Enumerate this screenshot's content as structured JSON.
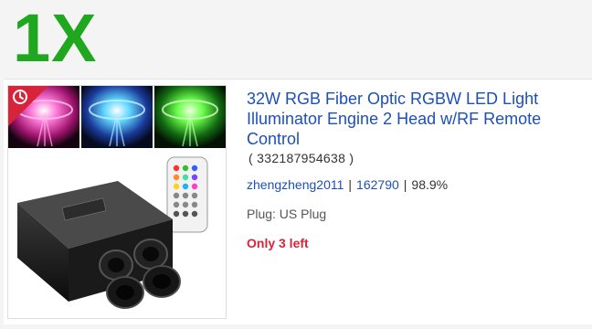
{
  "quantity_badge": "1X",
  "listing": {
    "title": "32W RGB Fiber Optic RGBW LED Light Illuminator Engine 2 Head w/RF Remote Control",
    "item_id": "( 332187954638 )",
    "seller_name": "zhengzheng2011",
    "feedback_score": "162790",
    "feedback_percent": "98.9%",
    "separator": "|",
    "plug": "Plug: US Plug",
    "stock_status": "Only 3 left",
    "thumbnail_icon": "clock-icon"
  },
  "colors": {
    "quantity": "#1fa81f",
    "link": "#1e4fb8",
    "stock": "#d8243a"
  }
}
